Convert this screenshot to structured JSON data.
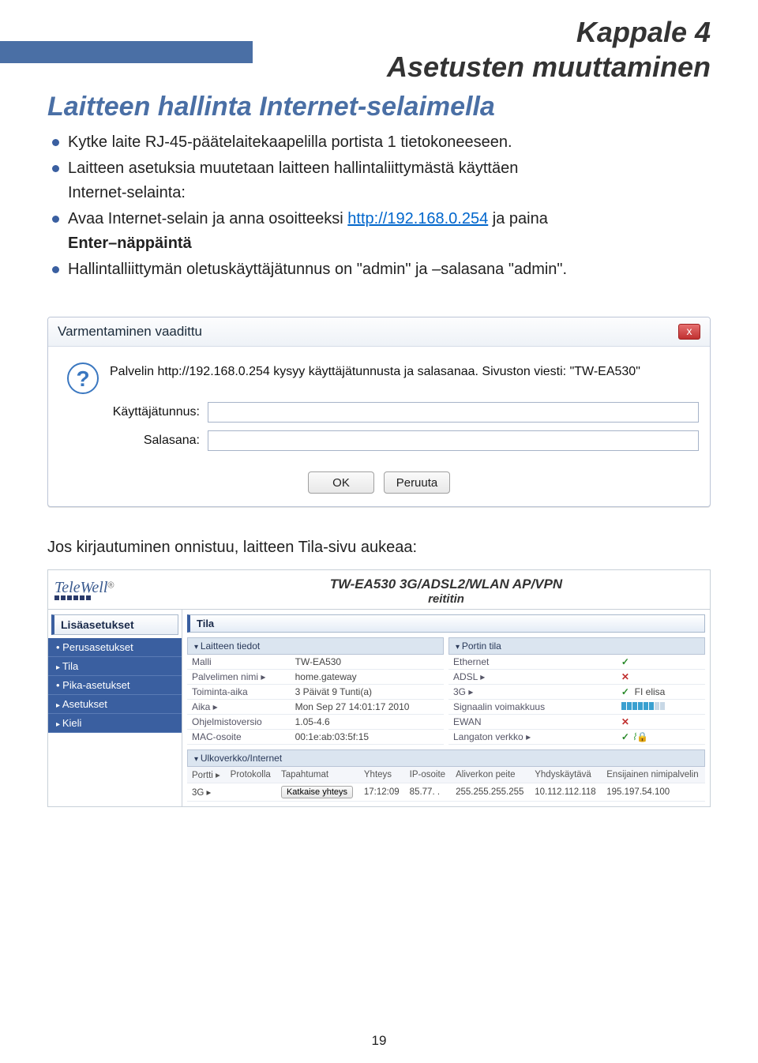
{
  "chapter": {
    "title": "Kappale 4",
    "subtitle": "Asetusten muuttaminen"
  },
  "section_title": "Laitteen hallinta Internet-selaimella",
  "bullets": {
    "b1": "Kytke laite RJ-45-päätelaitekaapelilla portista 1 tietokoneeseen.",
    "b2a": "Laitteen asetuksia muutetaan laitteen hallintaliittymästä käyttäen",
    "b2b": "Internet-selainta:",
    "b3a": "Avaa Internet-selain ja anna osoitteeksi ",
    "b3_link": "http://192.168.0.254",
    "b3b": " ja paina",
    "b3c": "Enter–näppäintä",
    "b4": "Hallintalliittymän oletuskäyttäjätunnus on \"admin\" ja –salasana \"admin\"."
  },
  "dialog": {
    "title": "Varmentaminen vaadittu",
    "message": "Palvelin http://192.168.0.254 kysyy käyttäjätunnusta ja salasanaa. Sivuston viesti: \"TW-EA530\"",
    "user_label": "Käyttäjätunnus:",
    "pass_label": "Salasana:",
    "ok": "OK",
    "cancel": "Peruuta",
    "close": "x"
  },
  "midtext": "Jos kirjautuminen onnistuu, laitteen Tila-sivu aukeaa:",
  "router": {
    "logo": "TeleWell",
    "title": "TW-EA530 3G/ADSL2/WLAN AP/VPN",
    "subtitle": "reititin",
    "side_tab": "Lisäasetukset",
    "menu": [
      "Perusasetukset",
      "Tila",
      "Pika-asetukset",
      "Asetukset",
      "Kieli"
    ],
    "main_tab": "Tila",
    "panel_device": "Laitteen tiedot",
    "panel_port": "Portin tila",
    "device": {
      "rows": [
        [
          "Malli",
          "TW-EA530"
        ],
        [
          "Palvelimen nimi ▸",
          "home.gateway"
        ],
        [
          "Toiminta-aika",
          "3 Päivät 9 Tunti(a)"
        ],
        [
          "Aika ▸",
          "Mon Sep 27 14:01:17 2010"
        ],
        [
          "Ohjelmistoversio",
          "1.05-4.6"
        ],
        [
          "MAC-osoite",
          "00:1e:ab:03:5f:15"
        ]
      ]
    },
    "port": {
      "rows": [
        [
          "Ethernet",
          "check",
          ""
        ],
        [
          "ADSL ▸",
          "x",
          ""
        ],
        [
          "3G ▸",
          "check",
          "FI elisa"
        ],
        [
          "Signaalin voimakkuus",
          "signal",
          ""
        ],
        [
          "EWAN",
          "x",
          ""
        ],
        [
          "Langaton verkko ▸",
          "check",
          "wifi-lock"
        ]
      ]
    },
    "wan": {
      "head": "Ulkoverkko/Internet",
      "columns": [
        "Portti ▸",
        "Protokolla",
        "Tapahtumat",
        "Yhteys",
        "IP-osoite",
        "Aliverkon peite",
        "Yhdyskäytävä",
        "Ensijainen nimipalvelin"
      ],
      "row": [
        "3G ▸",
        "",
        "Katkaise yhteys",
        "17:12:09",
        "85.77. .",
        "255.255.255.255",
        "10.112.112.118",
        "195.197.54.100"
      ]
    }
  },
  "pagenum": "19"
}
